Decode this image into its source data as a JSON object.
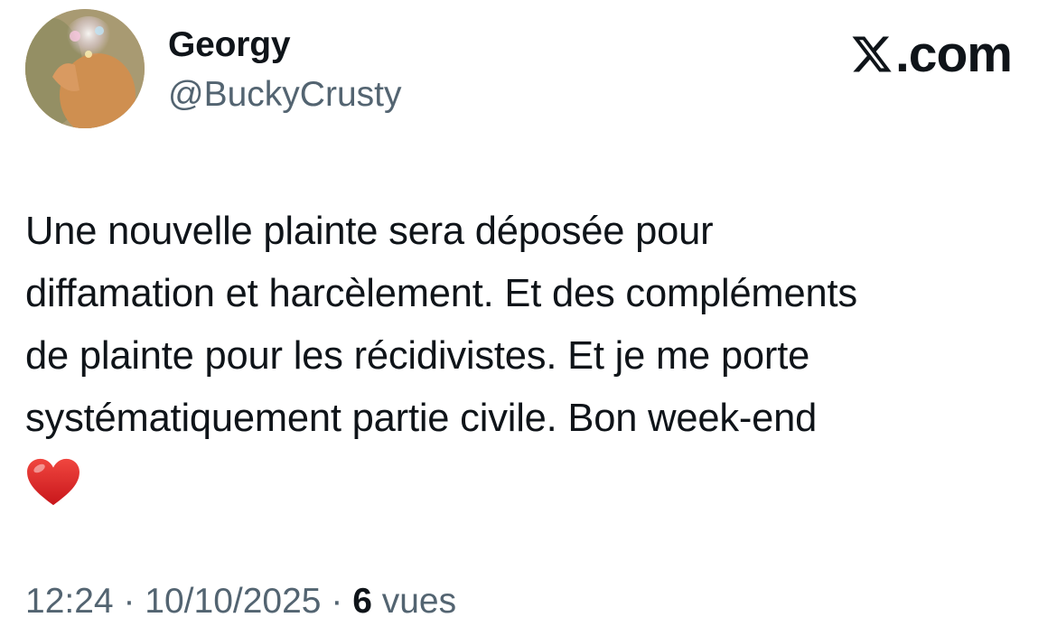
{
  "author": {
    "display_name": "Georgy",
    "handle": "@BuckyCrusty",
    "avatar": "profile-photo"
  },
  "brand": {
    "logo_icon": "x-logo-icon",
    "label": ".com"
  },
  "tweet": {
    "lines": [
      "Une nouvelle plainte sera déposée pour",
      "diffamation et harcèlement. Et des compléments",
      "de plainte pour les récidivistes. Et je me porte",
      "systématiquement partie civile. Bon week-end"
    ],
    "emoji": "red-heart-icon"
  },
  "meta": {
    "time": "12:24",
    "separator": "·",
    "date": "10/10/2025",
    "views_count": "6",
    "views_label": "vues"
  },
  "colors": {
    "text_primary": "#0f1419",
    "text_secondary": "#536471",
    "heart": "#e0201f"
  }
}
